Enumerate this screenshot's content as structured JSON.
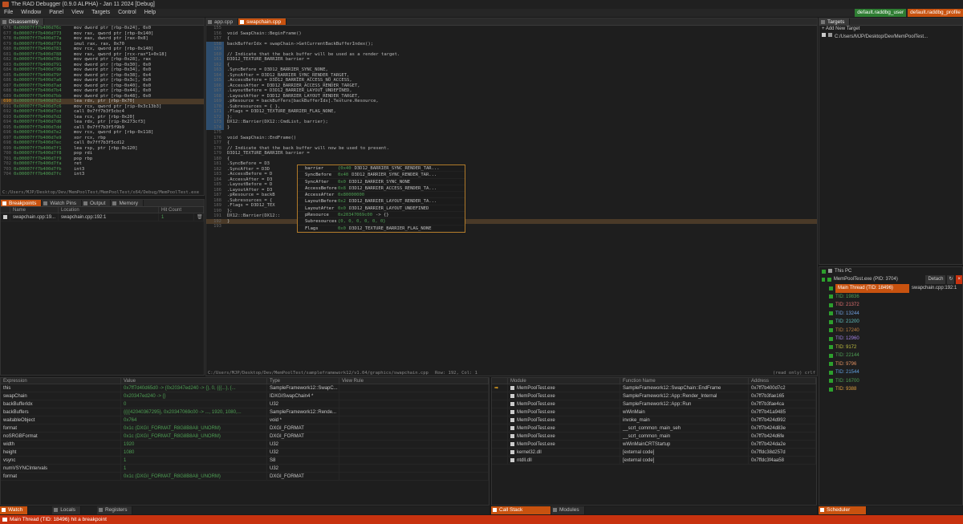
{
  "window": {
    "title": "The RAD Debugger (0.9.0 ALPHA) - Jan 11 2024 [Debug]"
  },
  "menu": [
    "File",
    "Window",
    "Panel",
    "View",
    "Targets",
    "Control",
    "Help"
  ],
  "profiles": {
    "user": "default.raddbg_user",
    "profile": "default.raddbg_profile",
    "user_color": "#2e7d32",
    "profile_color": "#c8520f"
  },
  "disasm": {
    "tab": "Disassembly",
    "lines": [
      {
        "n": "676",
        "a": "0x00007ff7b400d76c",
        "c": "mov dword ptr [rbp-0x24], 0x0"
      },
      {
        "n": "677",
        "a": "0x00007ff7b400d773",
        "c": "mov rax, qword ptr [rbp-0x140]"
      },
      {
        "n": "678",
        "a": "0x00007ff7b400d77a",
        "c": "mov eax, dword ptr [rax-0x8]"
      },
      {
        "n": "679",
        "a": "0x00007ff7b400d77d",
        "c": "imul rax, rax, 0x70"
      },
      {
        "n": "680",
        "a": "0x00007ff7b400d781",
        "c": "mov rcx, qword ptr [rbp-0x140]"
      },
      {
        "n": "681",
        "a": "0x00007ff7b400d788",
        "c": "mov rax, qword ptr [rcx-rax*1+0x18]"
      },
      {
        "n": "682",
        "a": "0x00007ff7b400d78d",
        "c": "mov qword ptr [rbp-0x28], rax"
      },
      {
        "n": "683",
        "a": "0x00007ff7b400d791",
        "c": "mov dword ptr [rbp-0x30], 0x0"
      },
      {
        "n": "684",
        "a": "0x00007ff7b400d798",
        "c": "mov dword ptr [rbp-0x34], 0x0"
      },
      {
        "n": "685",
        "a": "0x00007ff7b400d79f",
        "c": "mov dword ptr [rbp-0x38], 0x4"
      },
      {
        "n": "686",
        "a": "0x00007ff7b400d7a6",
        "c": "mov dword ptr [rbp-0x3c], 0x0"
      },
      {
        "n": "687",
        "a": "0x00007ff7b400d7ad",
        "c": "mov dword ptr [rbp-0x40], 0x0"
      },
      {
        "n": "688",
        "a": "0x00007ff7b400d7b4",
        "c": "mov dword ptr [rbp-0x44], 0x0"
      },
      {
        "n": "689",
        "a": "0x00007ff7b400d7bb",
        "c": "mov dword ptr [rbp-0x48], 0x0"
      },
      {
        "n": "690",
        "a": "0x00007ff7b400d7c2",
        "c": "lea rdx, ptr [rbp-0x70]"
      },
      {
        "n": "691",
        "a": "0x00007ff7b400d7c6",
        "c": "mov rcx, qword ptr [rip-0x3c13b3]"
      },
      {
        "n": "692",
        "a": "0x00007ff7b400d7cd",
        "c": "call 0x7ff7b3f5cbc4"
      },
      {
        "n": "693",
        "a": "0x00007ff7b400d7d2",
        "c": "lea rcx, ptr [rbp-0x20]"
      },
      {
        "n": "694",
        "a": "0x00007ff7b400d7d6",
        "c": "lea rdx, ptr [rip-0x273cf3]"
      },
      {
        "n": "695",
        "a": "0x00007ff7b400d7dd",
        "c": "call 0x7ff7b3f5f9b9"
      },
      {
        "n": "696",
        "a": "0x00007ff7b400d7e2",
        "c": "mov rcx, qword ptr [rbp-0x118]"
      },
      {
        "n": "697",
        "a": "0x00007ff7b400d7e9",
        "c": "xor rcx, rbp"
      },
      {
        "n": "698",
        "a": "0x00007ff7b400d7ec",
        "c": "call 0x7ff7b3f5cd12"
      },
      {
        "n": "699",
        "a": "0x00007ff7b400d7f1",
        "c": "lea rsp, ptr [rbp-0x120]"
      },
      {
        "n": "700",
        "a": "0x00007ff7b400d7f8",
        "c": "pop rdi"
      },
      {
        "n": "701",
        "a": "0x00007ff7b400d7f9",
        "c": "pop rbp"
      },
      {
        "n": "702",
        "a": "0x00007ff7b400d7fa",
        "c": "ret"
      },
      {
        "n": "703",
        "a": "0x00007ff7b400d7fb",
        "c": "int3"
      },
      {
        "n": "704",
        "a": "0x00007ff7b400d7fc",
        "c": "int3"
      }
    ],
    "path": "C:/Users/MJP/Desktop/Dev/MemPoolTest/MemPoolTest/x64/Debug/MemPoolTest.exe"
  },
  "bp": {
    "tabs": [
      "Breakpoints",
      "Watch Pins",
      "Output",
      "Memory"
    ],
    "headers": [
      "Name",
      "Location",
      "Hit Count"
    ],
    "rows": [
      {
        "name": "swapchain.cpp:19...",
        "loc": "swapchain.cpp:192:1",
        "hits": "1"
      }
    ]
  },
  "editor": {
    "tabs": [
      "app.cpp",
      "swapchain.cpp"
    ],
    "lines": [
      {
        "n": "155",
        "c": ""
      },
      {
        "n": "156",
        "c": "void SwapChain::BeginFrame()"
      },
      {
        "n": "157",
        "c": "{"
      },
      {
        "n": "158",
        "c": "    backBufferIdx = swapChain->GetCurrentBackBufferIndex();"
      },
      {
        "n": "159",
        "c": ""
      },
      {
        "n": "160",
        "c": "    // Indicate that the back buffer will be used as a render target."
      },
      {
        "n": "161",
        "c": "    D3D12_TEXTURE_BARRIER barrier ="
      },
      {
        "n": "162",
        "c": "    {"
      },
      {
        "n": "163",
        "c": "        .SyncBefore = D3D12_BARRIER_SYNC_NONE,"
      },
      {
        "n": "164",
        "c": "        .SyncAfter = D3D12_BARRIER_SYNC_RENDER_TARGET,"
      },
      {
        "n": "165",
        "c": "        .AccessBefore = D3D12_BARRIER_ACCESS_NO_ACCESS,"
      },
      {
        "n": "166",
        "c": "        .AccessAfter = D3D12_BARRIER_ACCESS_RENDER_TARGET,"
      },
      {
        "n": "167",
        "c": "        .LayoutBefore = D3D12_BARRIER_LAYOUT_UNDEFINED,"
      },
      {
        "n": "168",
        "c": "        .LayoutAfter = D3D12_BARRIER_LAYOUT_RENDER_TARGET,"
      },
      {
        "n": "169",
        "c": "        .pResource = backBuffers[backBufferIdx].Texture.Resource,"
      },
      {
        "n": "170",
        "c": "        .Subresources = { },"
      },
      {
        "n": "171",
        "c": "        .Flags = D3D12_TEXTURE_BARRIER_FLAG_NONE,"
      },
      {
        "n": "172",
        "c": "    };"
      },
      {
        "n": "173",
        "c": "    DX12::Barrier(DX12::CmdList, barrier);"
      },
      {
        "n": "174",
        "c": "}"
      },
      {
        "n": "175",
        "c": ""
      },
      {
        "n": "176",
        "c": "void SwapChain::EndFrame()"
      },
      {
        "n": "177",
        "c": "{"
      },
      {
        "n": "178",
        "c": "    // Indicate that the back buffer will now be used to present."
      },
      {
        "n": "179",
        "c": "    D3D12_TEXTURE_BARRIER barrier ="
      },
      {
        "n": "180",
        "c": "    {"
      },
      {
        "n": "181",
        "c": "        .SyncBefore = D3"
      },
      {
        "n": "182",
        "c": "        .SyncAfter = D3D"
      },
      {
        "n": "183",
        "c": "        .AccessBefore = D"
      },
      {
        "n": "184",
        "c": "        .AccessAfter = D3"
      },
      {
        "n": "185",
        "c": "        .LayoutBefore = D"
      },
      {
        "n": "186",
        "c": "        .LayoutAfter = D3"
      },
      {
        "n": "187",
        "c": "        .pResource = backB"
      },
      {
        "n": "188",
        "c": "        .Subresources = {"
      },
      {
        "n": "189",
        "c": "        .Flags = D3D12_TEX"
      },
      {
        "n": "190",
        "c": "    };"
      },
      {
        "n": "191",
        "c": "    DX12::Barrier(DX12::"
      },
      {
        "n": "192",
        "c": "}"
      },
      {
        "n": "193",
        "c": ""
      }
    ],
    "status_path": "C:/Users/MJP/Desktop/Dev/MemPoolTest/sampleframework12/v1.04/graphics/swapchain.cpp",
    "status_pos": "Row: 192, Col: 1",
    "status_ro": "(read only)  crlf"
  },
  "tooltip": {
    "rows": [
      {
        "k": "barrier",
        "v": "{0x40",
        "v2": "D3D12_BARRIER_SYNC_RENDER_TAR..."
      },
      {
        "k": "SyncBefore",
        "v": "0x40",
        "v2": "D3D12_BARRIER_SYNC_RENDER_TAR..."
      },
      {
        "k": "SyncAfter",
        "v": "0x0",
        "v2": "D3D12_BARRIER_SYNC_NONE"
      },
      {
        "k": "AccessBefore",
        "v": "0x8",
        "v2": "D3D12_BARRIER_ACCESS_RENDER_TA..."
      },
      {
        "k": "AccessAfter",
        "v": "0x80000000",
        "v2": ""
      },
      {
        "k": "LayoutBefore",
        "v": "0x2",
        "v2": "D3D12_BARRIER_LAYOUT_RENDER_TA..."
      },
      {
        "k": "LayoutAfter",
        "v": "0x0",
        "v2": "D3D12_BARRIER_LAYOUT_UNDEFINED"
      },
      {
        "k": "pResource",
        "v": "0x20347069c00",
        "v2": "-> {}"
      },
      {
        "k": "Subresources",
        "v": "{0, 0, 0, 0, 0, 0}",
        "v2": ""
      },
      {
        "k": "Flags",
        "v": "0x0",
        "v2": "D3D12_TEXTURE_BARRIER_FLAG_NONE"
      }
    ]
  },
  "targets": {
    "tab": "Targets",
    "add": "Add New Target",
    "target": "C:/Users/MJP/Desktop/Dev/MemPoolTest..."
  },
  "pc": {
    "header": "This PC",
    "process": "MemPoolTest.exe (PID: 3704)",
    "detach": "Detach",
    "main_thread": "Main Thread (TID: 18496)",
    "main_loc": "swapchain.cpp:192:1",
    "tids": [
      "TID: 19836",
      "TID: 21372",
      "TID: 13244",
      "TID: 21200",
      "TID: 17240",
      "TID: 12960",
      "TID: 9172",
      "TID: 22144",
      "TID: 9796",
      "TID: 21544",
      "TID: 16700",
      "TID: 9388"
    ]
  },
  "watch": {
    "headers": [
      "Expression",
      "Value",
      "Type",
      "View Rule"
    ],
    "rows": [
      {
        "e": "this",
        "v": "0x7ff7d40d65d0 -> {0x20347ed240 -> {}, 0, {{{...}, {...",
        "t": "SampleFramework12::SwapC..."
      },
      {
        "e": "  swapChain",
        "v": "0x20347ed240 -> {}",
        "t": "IDXGISwapChain4 *"
      },
      {
        "e": "  backBufferIdx",
        "v": "0",
        "t": "U32"
      },
      {
        "e": "  backBuffers",
        "v": "{{{{42040367295}, 0x20347069c00 -> ..., 1920, 1080,...",
        "t": "SampleFramework12::Rende..."
      },
      {
        "e": "  waitableObject",
        "v": "0x764",
        "t": "void *"
      },
      {
        "e": "  format",
        "v": "0x1c (DXGI_FORMAT_R8G8B8A8_UNORM)",
        "t": "DXGI_FORMAT"
      },
      {
        "e": "  noSRGBFormat",
        "v": "0x1c (DXGI_FORMAT_R8G8B8A8_UNORM)",
        "t": "DXGI_FORMAT"
      },
      {
        "e": "  width",
        "v": "1920",
        "t": "U32"
      },
      {
        "e": "  height",
        "v": "1080",
        "t": "U32"
      },
      {
        "e": "  vsync",
        "v": "1",
        "t": "S8"
      },
      {
        "e": "  numVSYNCIntervals",
        "v": "1",
        "t": "U32"
      },
      {
        "e": "format",
        "v": "0x1c (DXGI_FORMAT_R8G8B8A8_UNORM)",
        "t": "DXGI_FORMAT"
      }
    ],
    "tabs": [
      "Watch",
      "Locals",
      "Registers"
    ]
  },
  "callstack": {
    "headers": [
      "Module",
      "Function Name",
      "Address"
    ],
    "rows": [
      {
        "m": "MemPoolTest.exe",
        "f": "SampleFramework12::SwapChain::EndFrame",
        "a": "0x7ff7b400d7c2"
      },
      {
        "m": "MemPoolTest.exe",
        "f": "SampleFramework12::App::Render_Internal",
        "a": "0x7ff7b3fae165"
      },
      {
        "m": "MemPoolTest.exe",
        "f": "SampleFramework12::App::Run",
        "a": "0x7ff7b3fae4ca"
      },
      {
        "m": "MemPoolTest.exe",
        "f": "wWinMain",
        "a": "0x7ff7b41a9485"
      },
      {
        "m": "MemPoolTest.exe",
        "f": "invoke_main",
        "a": "0x7ff7b424d992"
      },
      {
        "m": "MemPoolTest.exe",
        "f": "__scrt_common_main_seh",
        "a": "0x7ff7b424d83e"
      },
      {
        "m": "MemPoolTest.exe",
        "f": "__scrt_common_main",
        "a": "0x7ff7b424d6fe"
      },
      {
        "m": "MemPoolTest.exe",
        "f": "wWinMainCRTStartup",
        "a": "0x7ff7b424da2e"
      },
      {
        "m": "kernel32.dll",
        "f": "[external code]",
        "a": "0x7ffdc38d257d"
      },
      {
        "m": "ntdll.dll",
        "f": "[external code]",
        "a": "0x7ffdc3f4aa58"
      }
    ],
    "tabs": [
      "Call Stack",
      "Modules"
    ]
  },
  "scheduler_tab": "Scheduler",
  "status": "Main Thread (TID: 18496) hit a breakpoint"
}
